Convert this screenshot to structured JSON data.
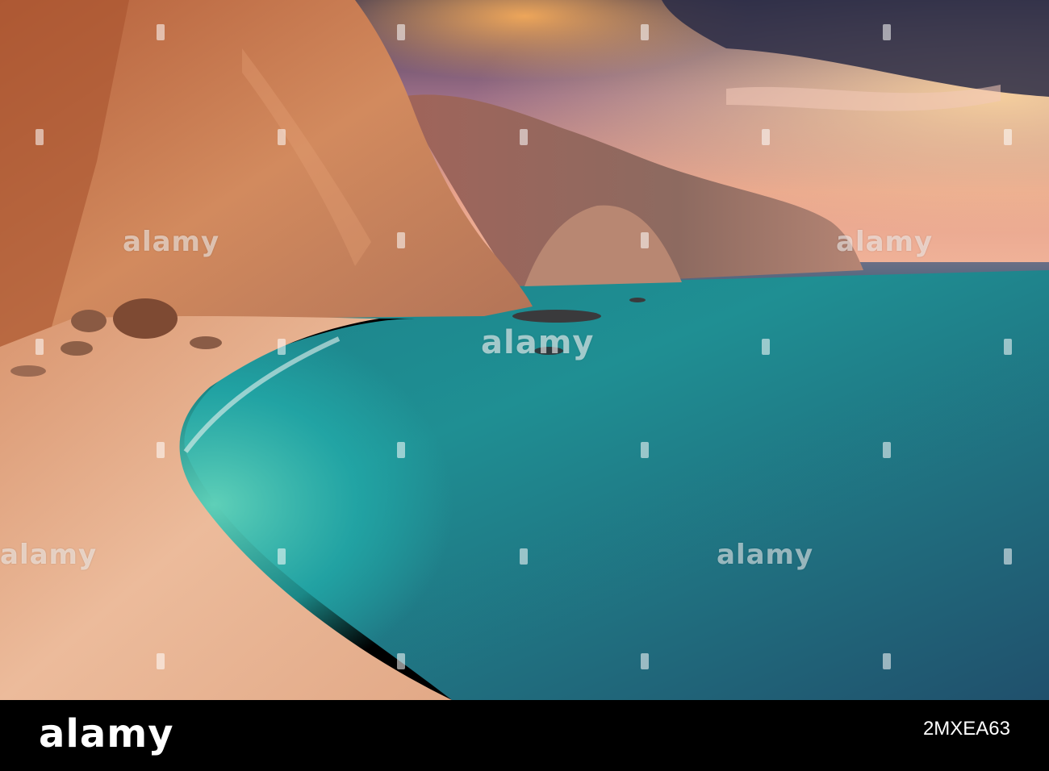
{
  "photo": {
    "subject": "Coastal cliffs above a white pebble beach and turquoise sea at sunset",
    "watermark_text": "alamy",
    "watermarks": [
      {
        "id": "wm-1",
        "text": "alamy"
      },
      {
        "id": "wm-2",
        "text": "alamy"
      },
      {
        "id": "wm-3",
        "text": "alamy"
      },
      {
        "id": "wm-4",
        "text": "alamy"
      },
      {
        "id": "wm-5",
        "text": "alamy"
      },
      {
        "id": "wm-6",
        "text": "alamy"
      }
    ]
  },
  "footer": {
    "brand": "alamy",
    "image_id": "2MXEA63"
  },
  "colors": {
    "sky_top": "#2b2a45",
    "sky_glow": "#f3a57a",
    "cliff": "#c8734a",
    "sea_turquoise": "#1fa6a4",
    "sea_deep": "#1f4f6d",
    "sand": "#e8b493",
    "footer_bg": "#000000"
  }
}
